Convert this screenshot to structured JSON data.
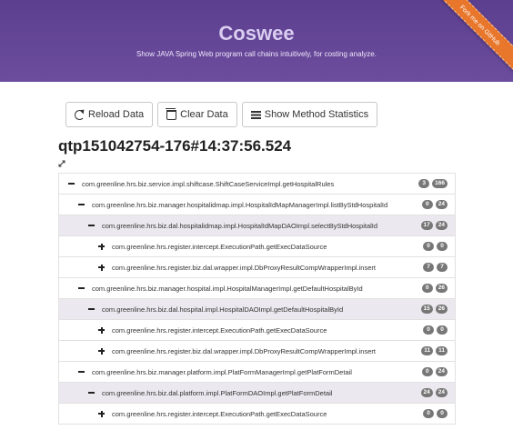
{
  "header": {
    "title": "Coswee",
    "subtitle": "Show JAVA Spring Web program call chains intuitively, for costing analyze.",
    "ribbon_text": "Fork me on GitHub",
    "colors": {
      "background": "#6b4c9d",
      "ribbon": "#e8762b"
    }
  },
  "toolbar": {
    "reload_label": "Reload Data",
    "reload_icon": "refresh-icon",
    "clear_label": "Clear Data",
    "clear_icon": "trash-icon",
    "stats_label": "Show Method Statistics",
    "stats_icon": "list-icon"
  },
  "page": {
    "title": "qtp151042754-176#14:37:56.524",
    "expand_icon": "expand-arrows-icon"
  },
  "tree": {
    "rows": [
      {
        "depth": 0,
        "toggle": "minus",
        "label": "com.greenline.hrs.biz.service.impl.shiftcase.ShiftCaseServiceImpl.getHospitalRules",
        "a": "3",
        "b": "166",
        "selected": false
      },
      {
        "depth": 1,
        "toggle": "minus",
        "label": "com.greenline.hrs.biz.manager.hospitalidmap.impl.HospitalIdMapManagerImpl.listByStdHospitalId",
        "a": "0",
        "b": "24",
        "selected": false
      },
      {
        "depth": 2,
        "toggle": "minus",
        "label": "com.greenline.hrs.biz.dal.hospitalidmap.impl.HospitalIdMapDAOImpl.selectByStdHospitalId",
        "a": "17",
        "b": "24",
        "selected": true
      },
      {
        "depth": 3,
        "toggle": "plus",
        "label": "com.greenline.hrs.register.intercept.ExecutionPath.getExecDataSource",
        "a": "0",
        "b": "0",
        "selected": false
      },
      {
        "depth": 3,
        "toggle": "plus",
        "label": "com.greenline.hrs.register.biz.dal.wrapper.impl.DbProxyResultCompWrapperImpl.insert",
        "a": "7",
        "b": "7",
        "selected": false
      },
      {
        "depth": 1,
        "toggle": "minus",
        "label": "com.greenline.hrs.biz.manager.hospital.impl.HospitalManagerImpl.getDefaultHospitalById",
        "a": "0",
        "b": "26",
        "selected": false
      },
      {
        "depth": 2,
        "toggle": "minus",
        "label": "com.greenline.hrs.biz.dal.hospital.impl.HospitalDAOImpl.getDefaultHospitalById",
        "a": "15",
        "b": "26",
        "selected": true
      },
      {
        "depth": 3,
        "toggle": "plus",
        "label": "com.greenline.hrs.register.intercept.ExecutionPath.getExecDataSource",
        "a": "0",
        "b": "0",
        "selected": false
      },
      {
        "depth": 3,
        "toggle": "plus",
        "label": "com.greenline.hrs.register.biz.dal.wrapper.impl.DbProxyResultCompWrapperImpl.insert",
        "a": "11",
        "b": "11",
        "selected": false
      },
      {
        "depth": 1,
        "toggle": "minus",
        "label": "com.greenline.hrs.biz.manager.platform.impl.PlatFormManagerImpl.getPlatFormDetail",
        "a": "0",
        "b": "24",
        "selected": false
      },
      {
        "depth": 2,
        "toggle": "minus",
        "label": "com.greenline.hrs.biz.dal.platform.impl.PlatFormDAOImpl.getPlatFormDetail",
        "a": "24",
        "b": "24",
        "selected": true
      },
      {
        "depth": 3,
        "toggle": "plus",
        "label": "com.greenline.hrs.register.intercept.ExecutionPath.getExecDataSource",
        "a": "0",
        "b": "0",
        "selected": false
      }
    ]
  }
}
